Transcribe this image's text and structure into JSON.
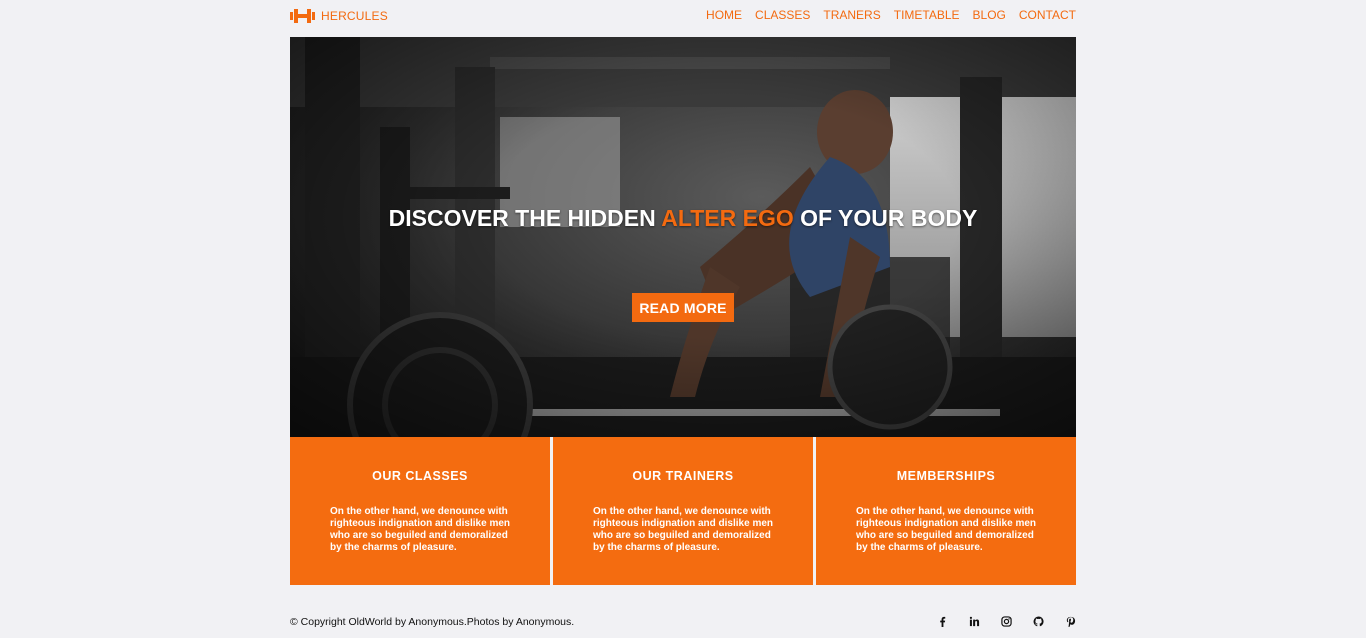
{
  "brand": {
    "name": "HERCULES",
    "color": "#f36a10"
  },
  "nav": {
    "items": [
      "HOME",
      "CLASSES",
      "TRANERS",
      "TIMETABLE",
      "BLOG",
      "CONTACT"
    ]
  },
  "hero": {
    "headline_before": "DISCOVER THE HIDDEN ",
    "headline_accent": "ALTER EGO",
    "headline_after": " OF YOUR BODY",
    "button_label": "READ MORE",
    "accent_color": "#f36a10"
  },
  "cards": [
    {
      "title": "OUR CLASSES",
      "text": "On the other hand, we denounce with righteous indignation and dislike men who are so beguiled and demoralized by the charms of pleasure."
    },
    {
      "title": "OUR TRAINERS",
      "text": "On the other hand, we denounce with righteous indignation and dislike men who are so beguiled and demoralized by the charms of pleasure."
    },
    {
      "title": "MEMBERSHIPS",
      "text": "On the other hand, we denounce with righteous indignation and dislike men who are so beguiled and demoralized by the charms of pleasure."
    }
  ],
  "footer": {
    "copyright": "© Copyright OldWorld by Anonymous.Photos by Anonymous.",
    "social_icons": [
      "facebook-icon",
      "linkedin-icon",
      "instagram-icon",
      "github-icon",
      "pinterest-icon"
    ]
  }
}
